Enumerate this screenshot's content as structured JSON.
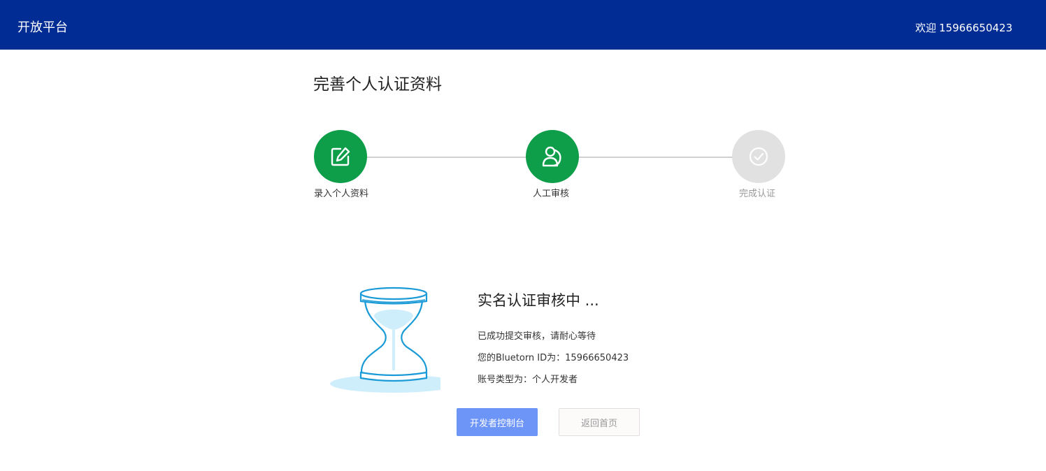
{
  "header": {
    "brand": "开放平台",
    "welcome_prefix": "欢迎",
    "username": "15966650423"
  },
  "page": {
    "title": "完善个人认证资料"
  },
  "steps": [
    {
      "label": "录入个人资料",
      "icon": "edit-icon",
      "state": "done"
    },
    {
      "label": "人工审核",
      "icon": "review-person-icon",
      "state": "done"
    },
    {
      "label": "完成认证",
      "icon": "check-circle-icon",
      "state": "todo"
    }
  ],
  "status": {
    "title": "实名认证审核中 ...",
    "line1": "已成功提交审核，请耐心等待",
    "line2": "您的Bluetorn ID为：15966650423",
    "line3": "账号类型为：个人开发者",
    "illustration": "hourglass-icon"
  },
  "buttons": {
    "console": "开发者控制台",
    "home": "返回首页"
  },
  "colors": {
    "header_bg": "#002c94",
    "step_done": "#0e9e4a",
    "step_todo": "#e1e1e1",
    "primary_button": "#6d95f8",
    "hourglass_stroke": "#1a9ad6",
    "hourglass_fill": "#cfeefc"
  }
}
